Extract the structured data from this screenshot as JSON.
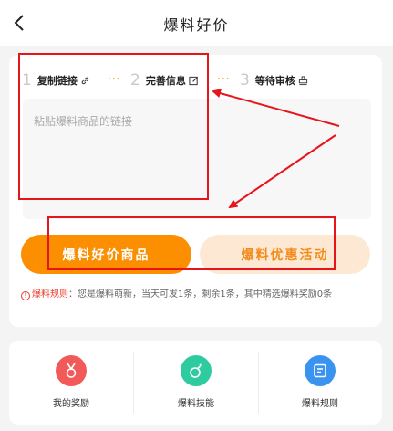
{
  "header": {
    "title": "爆料好价"
  },
  "steps": [
    {
      "num": "1",
      "label": "复制链接"
    },
    {
      "num": "2",
      "label": "完善信息"
    },
    {
      "num": "3",
      "label": "等待审核"
    }
  ],
  "step_separator": "···",
  "paste": {
    "placeholder": "粘贴爆料商品的链接"
  },
  "buttons": {
    "primary": "爆料好价商品",
    "secondary": "爆料优惠活动"
  },
  "rules": {
    "badge": "!",
    "title": "爆料规则",
    "text": "：您是爆料萌新，当天可发1条，剩余1条，其中精选爆料奖励0条"
  },
  "features": [
    {
      "label": "我的奖励",
      "color": "#f25a5a"
    },
    {
      "label": "爆料技能",
      "color": "#2fcba0"
    },
    {
      "label": "爆料规则",
      "color": "#3b93f0"
    }
  ],
  "annotation_color": "#e8141c"
}
